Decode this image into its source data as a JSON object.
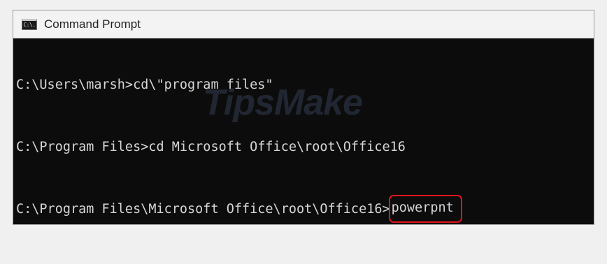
{
  "window": {
    "title": "Command Prompt",
    "icon": "cmd-icon",
    "icon_glyph": "C:\\."
  },
  "console": {
    "lines": [
      "C:\\Users\\marsh>cd\\\"program files\"",
      "C:\\Program Files>cd Microsoft Office\\root\\Office16",
      "C:\\Program Files\\Microsoft Office\\root\\Office16>"
    ],
    "highlighted_command": "powerpnt",
    "highlight_color": "#e0141c"
  },
  "watermark": "TipsMake"
}
